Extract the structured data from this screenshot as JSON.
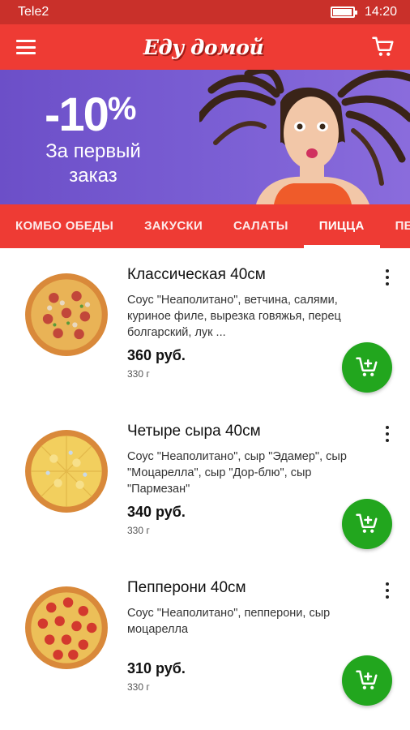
{
  "status_bar": {
    "carrier": "Tele2",
    "time": "14:20",
    "battery_level": 0.9
  },
  "app_bar": {
    "logo_text": "Еду домой",
    "menu_icon": "hamburger-menu-icon",
    "cart_icon": "shopping-cart-icon"
  },
  "banner": {
    "discount": "-10",
    "percent_sign": "%",
    "line1": "За первый",
    "line2": "заказ"
  },
  "tabs": [
    {
      "label": "КОМБО ОБЕДЫ",
      "active": false
    },
    {
      "label": "ЗАКУСКИ",
      "active": false
    },
    {
      "label": "САЛАТЫ",
      "active": false
    },
    {
      "label": "ПИЦЦА",
      "active": true
    },
    {
      "label": "ПЕ",
      "active": false
    }
  ],
  "products": [
    {
      "name": "Классическая 40см",
      "description": "Соус \"Неаполитано\", ветчина, салями, куриное филе, вырезка говяжья, перец болгарский, лук ...",
      "price": "360 руб.",
      "weight": "330 г"
    },
    {
      "name": "Четыре сыра 40см",
      "description": "Соус \"Неаполитано\", сыр \"Эдамер\", сыр \"Моцарелла\", сыр \"Дор-блю\", сыр \"Пармезан\"",
      "price": "340 руб.",
      "weight": "330 г"
    },
    {
      "name": "Пепперони 40см",
      "description": "Соус \"Неаполитано\", пепперони, сыр моцарелла",
      "price": "310 руб.",
      "weight": "330 г"
    }
  ],
  "colors": {
    "primary": "#ee3b34",
    "status_bar": "#c9302a",
    "banner": "#7b5fd4",
    "add_button": "#22a61e"
  }
}
